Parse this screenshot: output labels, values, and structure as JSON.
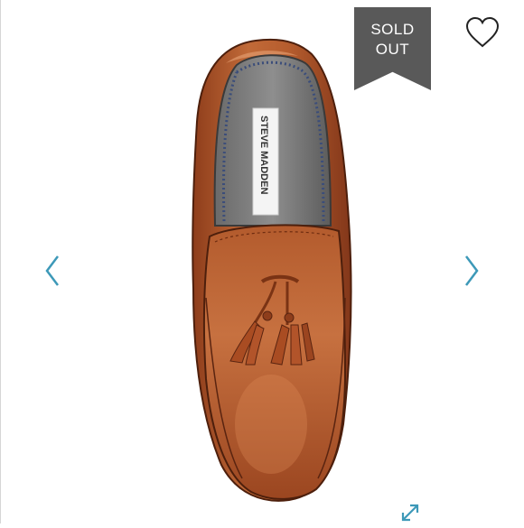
{
  "listing": {
    "status_badge": {
      "line1": "SOLD",
      "line2": "OUT"
    },
    "image": {
      "brand_label": "STEVE MADDEN",
      "description": "Cognac leather tassel loafer, top view"
    },
    "controls": {
      "like_icon": "heart-icon",
      "prev_icon": "chevron-left-icon",
      "next_icon": "chevron-right-icon",
      "expand_icon": "expand-icon"
    },
    "colors": {
      "accent": "#3d99b8",
      "badge": "#595959",
      "leather": "#b25a2c"
    }
  }
}
